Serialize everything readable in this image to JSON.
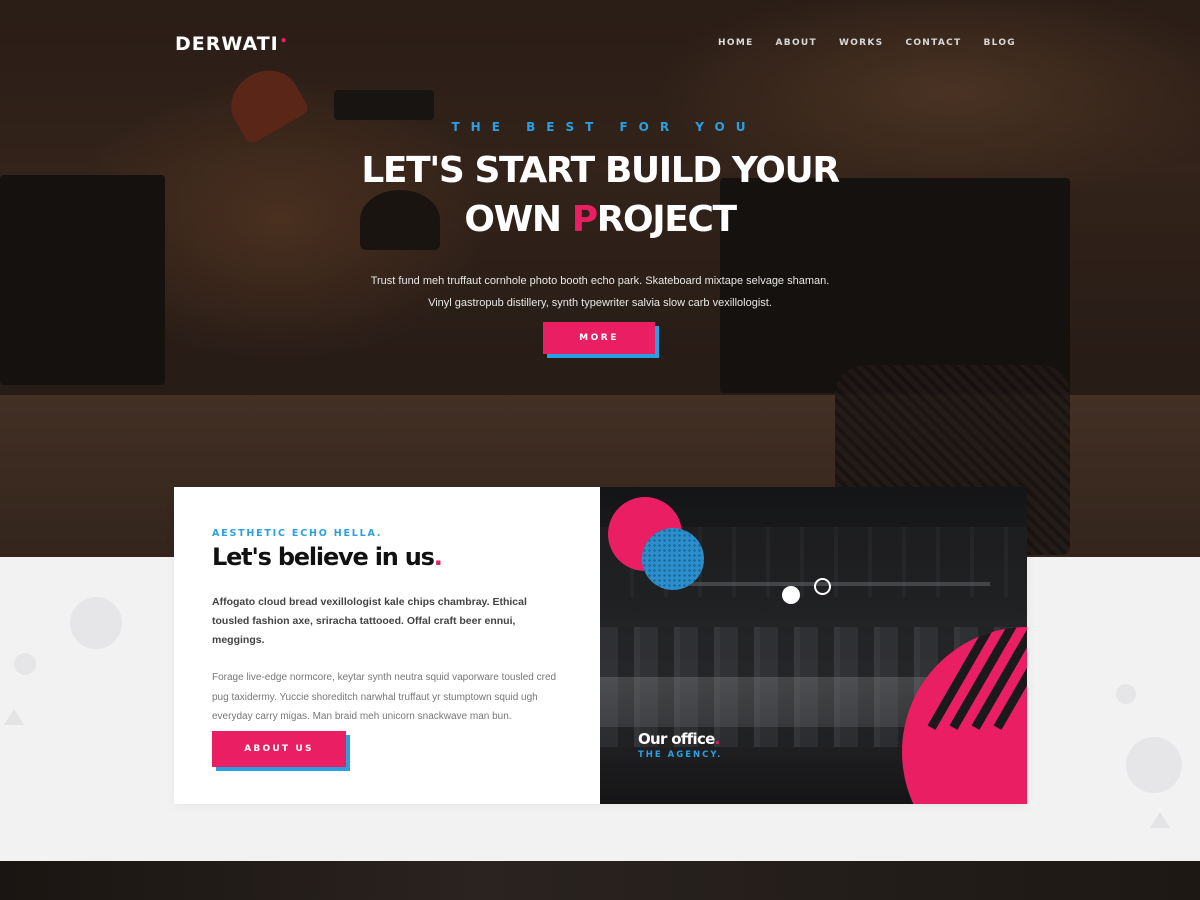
{
  "brand": {
    "logo_text": "DERWATI",
    "logo_mark": "•",
    "accent_color": "#e91e63",
    "secondary_color": "#2aa0e4"
  },
  "nav": {
    "items": [
      {
        "label": "HOME"
      },
      {
        "label": "ABOUT"
      },
      {
        "label": "WORKS"
      },
      {
        "label": "CONTACT"
      },
      {
        "label": "BLOG"
      }
    ]
  },
  "hero": {
    "eyebrow": "THE BEST FOR YOU",
    "title_line1": "LET'S START BUILD YOUR",
    "title_line2_pre": "OWN ",
    "title_line2_accent": "P",
    "title_line2_post": "ROJECT",
    "text": "Trust fund meh truffaut cornhole photo booth echo park. Skateboard mixtape selvage shaman. Vinyl gastropub distillery, synth typewriter salvia slow carb vexillologist.",
    "button_label": "MORE"
  },
  "about": {
    "eyebrow": "AESTHETIC ECHO HELLA.",
    "title": "Let's believe in us",
    "title_dot": ".",
    "lead": "Affogato cloud bread vexillologist kale chips chambray. Ethical tousled fashion axe, sriracha tattooed. Offal craft beer ennui, meggings.",
    "body": "Forage live-edge normcore, keytar synth neutra squid vaporware tousled cred pug taxidermy. Yuccie shoreditch narwhal truffaut yr stumptown squid ugh everyday carry migas. Man braid meh unicorn snackwave man bun.",
    "button_label": "ABOUT US"
  },
  "office": {
    "title": "Our office",
    "title_dot": ".",
    "subtitle": "THE AGENCY."
  }
}
